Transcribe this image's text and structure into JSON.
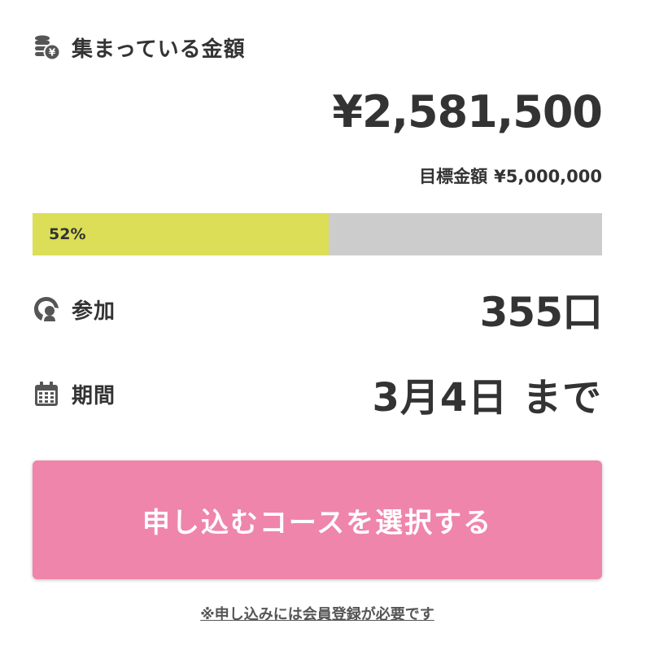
{
  "collected": {
    "label": "集まっている金額",
    "icon": "coins-yen-icon",
    "amount": "¥2,581,500"
  },
  "goal": {
    "label": "目標金額",
    "amount": "¥5,000,000"
  },
  "progress": {
    "percent_text": "52%",
    "fraction": 0.52,
    "fill_color": "#dbde56",
    "track_color": "#cccccc"
  },
  "supporters": {
    "label": "参加",
    "icon": "supporter-icon",
    "value": "355口"
  },
  "period": {
    "label": "期間",
    "icon": "calendar-icon",
    "value": "3月4日 まで"
  },
  "cta": {
    "label": "申し込むコースを選択する",
    "color": "#ef85ab"
  },
  "note": {
    "text": "※申し込みには会員登録が必要です"
  }
}
